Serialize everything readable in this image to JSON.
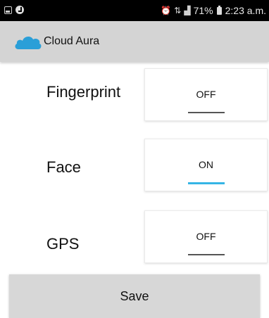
{
  "status_bar": {
    "battery": "71%",
    "time": "2:23 a.m."
  },
  "app_bar": {
    "title": "Cloud Aura",
    "icon": "cloud-icon",
    "icon_color": "#2a9fd8"
  },
  "settings": [
    {
      "label": "Fingerprint",
      "state": "OFF"
    },
    {
      "label": "Face",
      "state": "ON"
    },
    {
      "label": "GPS",
      "state": "OFF"
    }
  ],
  "save_label": "Save",
  "colors": {
    "toggle_on_indicator": "#35b5e5",
    "toggle_off_indicator": "#555555",
    "app_bar": "#d4d4d4",
    "save_button": "#d7d7d7"
  }
}
